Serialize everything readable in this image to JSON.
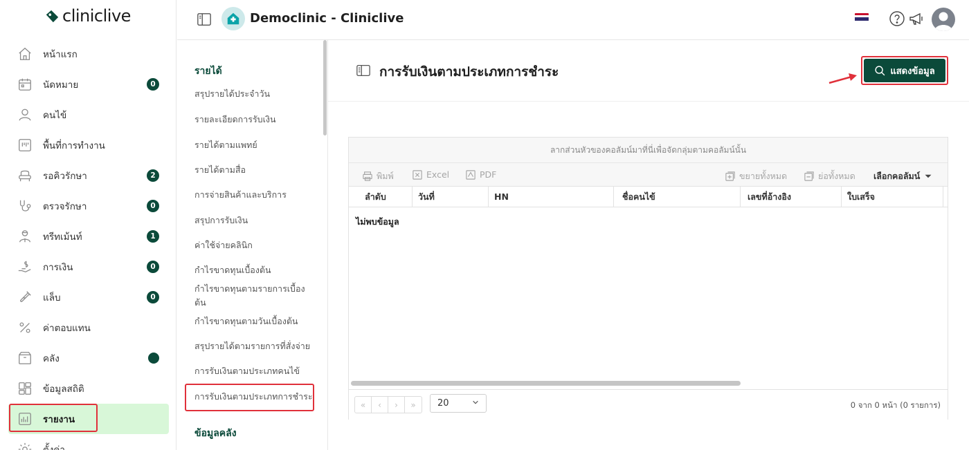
{
  "brand": {
    "logo_text": "cliniclive",
    "color": "#0b4a3a"
  },
  "header": {
    "clinic_name": "Democlinic - Cliniclive",
    "icons": [
      "panel-toggle-icon",
      "clinic-home-icon",
      "thai-flag",
      "help-icon",
      "megaphone-icon",
      "user-avatar"
    ]
  },
  "sidebar": {
    "items": [
      {
        "label": "หน้าแรก",
        "icon": "home-icon",
        "badge": ""
      },
      {
        "label": "นัดหมาย",
        "icon": "calendar-icon",
        "badge": "0"
      },
      {
        "label": "คนไข้",
        "icon": "user-icon",
        "badge": ""
      },
      {
        "label": "พื้นที่การทำงาน",
        "icon": "workspace-icon",
        "badge": ""
      },
      {
        "label": "รอคิวรักษา",
        "icon": "waiting-chair-icon",
        "badge": "2"
      },
      {
        "label": "ตรวจรักษา",
        "icon": "stethoscope-icon",
        "badge": "0"
      },
      {
        "label": "ทรีทเม้นท์",
        "icon": "treatment-icon",
        "badge": "1"
      },
      {
        "label": "การเงิน",
        "icon": "money-hand-icon",
        "badge": "0"
      },
      {
        "label": "แล็บ",
        "icon": "lab-tube-icon",
        "badge": "0"
      },
      {
        "label": "ค่าตอบแทน",
        "icon": "percent-icon",
        "badge": ""
      },
      {
        "label": "คลัง",
        "icon": "box-icon",
        "badge": ""
      },
      {
        "label": "ข้อมูลสถิติ",
        "icon": "dashboard-icon",
        "badge": ""
      },
      {
        "label": "รายงาน",
        "icon": "report-chart-icon",
        "badge": ""
      },
      {
        "label": "ตั้งค่า",
        "icon": "gear-icon",
        "badge": ""
      }
    ]
  },
  "submenu": {
    "section_income": "รายได้",
    "items": [
      "สรุปรายได้ประจำวัน",
      "รายละเอียดการรับเงิน",
      "รายได้ตามแพทย์",
      "รายได้ตามสื่อ",
      "การจ่ายสินค้าและบริการ",
      "สรุปการรับเงิน",
      "ค่าใช้จ่ายคลินิก",
      "กำไรขาดทุนเบื้องต้น",
      "กำไรขาดทุนตามรายการเบื้องต้น",
      "กำไรขาดทุนตามวันเบื้องต้น",
      "สรุปรายได้ตามรายการที่สั่งจ่าย",
      "การรับเงินตามประเภทคนไข้",
      "การรับเงินตามประเภทการชำระ"
    ],
    "section_stock": "ข้อมูลคลัง"
  },
  "main": {
    "title": "การรับเงินตามประเภทการชำระ",
    "show_button": "แสดงข้อมูล"
  },
  "grid": {
    "group_hint": "ลากส่วนหัวของคอลัมน์มาที่นี่เพื่อจัดกลุ่มตามคอลัมน์นั้น",
    "toolbar": {
      "print": "พิมพ์",
      "excel": "Excel",
      "pdf": "PDF",
      "expand_all": "ขยายทั้งหมด",
      "collapse_all": "ย่อทั้งหมด",
      "choose_columns": "เลือกคอลัมน์"
    },
    "columns": [
      "ลำดับ",
      "วันที่",
      "HN",
      "ชื่อคนไข้",
      "เลขที่อ้างอิง",
      "ใบเสร็จ"
    ],
    "empty_text": "ไม่พบข้อมูล",
    "pager": {
      "buttons": [
        "«",
        "‹",
        "›",
        "»"
      ],
      "page_size": "20",
      "info": "0 จาก 0 หน้า (0 รายการ)"
    }
  }
}
